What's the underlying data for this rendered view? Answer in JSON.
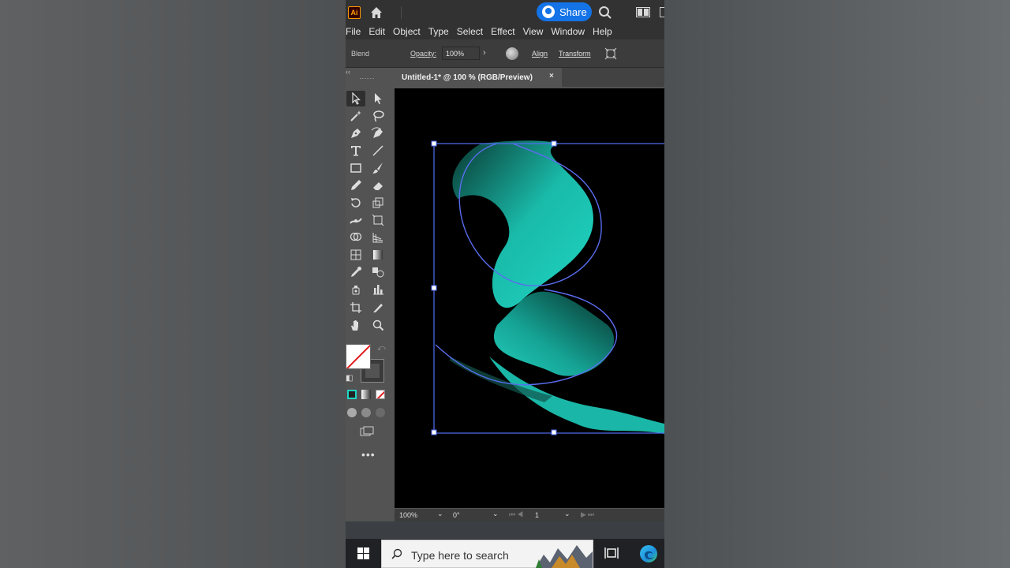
{
  "titlebar": {
    "app_badge": "Ai",
    "share_label": "Share"
  },
  "menu": [
    "File",
    "Edit",
    "Object",
    "Type",
    "Select",
    "Effect",
    "View",
    "Window",
    "Help"
  ],
  "control_bar": {
    "selection_label": "Blend",
    "opacity_label": "Opacity:",
    "opacity_value": "100%",
    "align_label": "Align",
    "transform_label": "Transform"
  },
  "document": {
    "tab_title": "Untitled-1* @ 100 % (RGB/Preview)",
    "tab_close": "×"
  },
  "status_bar": {
    "zoom": "100%",
    "rotation": "0°",
    "artboard": "1"
  },
  "taskbar": {
    "search_placeholder": "Type here to search"
  },
  "colors": {
    "accent": "#1473e6",
    "selection": "#4f6ef7",
    "artwork": "#1fd6c4"
  }
}
